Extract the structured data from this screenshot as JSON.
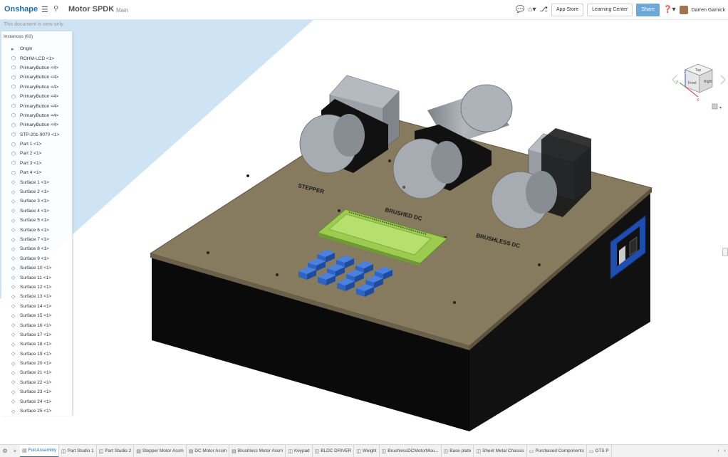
{
  "header": {
    "brand": "Onshape",
    "menu_icon": "hamburger-icon",
    "filter_icon": "filter-icon",
    "doc_title": "Motor SPDK",
    "doc_branch": "Main",
    "comment_icon": "comment-icon",
    "home_icon": "home-icon",
    "version_icon": "version-icon",
    "app_store": "App Store",
    "learning_center": "Learning Center",
    "share": "Share",
    "help_icon": "help-icon",
    "user": "Darren Garnick"
  },
  "readonly_notice": "This document is view only.",
  "feature_panel": {
    "title": "Instances (63)",
    "items": [
      {
        "icon": "chevron-icon",
        "label": "Origin"
      },
      {
        "icon": "part-icon",
        "label": "ROHM-LCD <1>"
      },
      {
        "icon": "part-icon",
        "label": "PrimaryButton <4>"
      },
      {
        "icon": "part-icon",
        "label": "PrimaryButton <4>"
      },
      {
        "icon": "part-icon",
        "label": "PrimaryButton <4>"
      },
      {
        "icon": "part-icon",
        "label": "PrimaryButton <4>"
      },
      {
        "icon": "part-icon",
        "label": "PrimaryButton <4>"
      },
      {
        "icon": "part-icon",
        "label": "PrimaryButton <4>"
      },
      {
        "icon": "part-icon",
        "label": "PrimaryButton <4>"
      },
      {
        "icon": "part-icon",
        "label": "STP-201-9070 <1>"
      },
      {
        "icon": "part-icon",
        "label": "Part 1 <1>"
      },
      {
        "icon": "part-icon",
        "label": "Part 2 <1>"
      },
      {
        "icon": "part-icon",
        "label": "Part 3 <1>"
      },
      {
        "icon": "part-icon",
        "label": "Part 4 <1>"
      },
      {
        "icon": "surface-icon",
        "label": "Surface 1 <1>"
      },
      {
        "icon": "surface-icon",
        "label": "Surface 2 <1>"
      },
      {
        "icon": "surface-icon",
        "label": "Surface 3 <1>"
      },
      {
        "icon": "surface-icon",
        "label": "Surface 4 <1>"
      },
      {
        "icon": "surface-icon",
        "label": "Surface 5 <1>"
      },
      {
        "icon": "surface-icon",
        "label": "Surface 6 <1>"
      },
      {
        "icon": "surface-icon",
        "label": "Surface 7 <1>"
      },
      {
        "icon": "surface-icon",
        "label": "Surface 8 <1>"
      },
      {
        "icon": "surface-icon",
        "label": "Surface 9 <1>"
      },
      {
        "icon": "surface-icon",
        "label": "Surface 10 <1>"
      },
      {
        "icon": "surface-icon",
        "label": "Surface 11 <1>"
      },
      {
        "icon": "surface-icon",
        "label": "Surface 12 <1>"
      },
      {
        "icon": "surface-icon",
        "label": "Surface 13 <1>"
      },
      {
        "icon": "surface-icon",
        "label": "Surface 14 <1>"
      },
      {
        "icon": "surface-icon",
        "label": "Surface 15 <1>"
      },
      {
        "icon": "surface-icon",
        "label": "Surface 16 <1>"
      },
      {
        "icon": "surface-icon",
        "label": "Surface 17 <1>"
      },
      {
        "icon": "surface-icon",
        "label": "Surface 18 <1>"
      },
      {
        "icon": "surface-icon",
        "label": "Surface 19 <1>"
      },
      {
        "icon": "surface-icon",
        "label": "Surface 20 <1>"
      },
      {
        "icon": "surface-icon",
        "label": "Surface 21 <1>"
      },
      {
        "icon": "surface-icon",
        "label": "Surface 22 <1>"
      },
      {
        "icon": "surface-icon",
        "label": "Surface 23 <1>"
      },
      {
        "icon": "surface-icon",
        "label": "Surface 24 <1>"
      },
      {
        "icon": "surface-icon",
        "label": "Surface 25 <1>"
      }
    ]
  },
  "model_labels": {
    "stepper": "STEPPER",
    "brushed": "BRUSHED DC",
    "brushless": "BRUSHLESS DC"
  },
  "view_cube": {
    "top": "Top",
    "front": "Front",
    "right": "Right",
    "axis_x": "X",
    "axis_y": "Y",
    "axis_z": "Z"
  },
  "colors": {
    "accent": "#1f6fb0",
    "plate": "#867a5f",
    "lcd": "#a6d65a",
    "keys": "#2f64c4",
    "base": "#0c0c0c"
  },
  "tabs": [
    {
      "icon": "assembly-icon",
      "label": "Full Assembly",
      "active": true
    },
    {
      "icon": "part-studio-icon",
      "label": "Part Studio 1"
    },
    {
      "icon": "part-studio-icon",
      "label": "Part Studio 2"
    },
    {
      "icon": "assembly-icon",
      "label": "Stepper Motor Assm"
    },
    {
      "icon": "assembly-icon",
      "label": "DC Motor Assm"
    },
    {
      "icon": "assembly-icon",
      "label": "Brushless Motor Assm"
    },
    {
      "icon": "part-studio-icon",
      "label": "Keypad"
    },
    {
      "icon": "part-studio-icon",
      "label": "BLDC DRIVER"
    },
    {
      "icon": "part-studio-icon",
      "label": "Weight"
    },
    {
      "icon": "part-studio-icon",
      "label": "BrushlessDCMotorMou..."
    },
    {
      "icon": "part-studio-icon",
      "label": "Base plate"
    },
    {
      "icon": "part-studio-icon",
      "label": "Sheet Metal Chassis"
    },
    {
      "icon": "folder-icon",
      "label": "Purchased Components"
    },
    {
      "icon": "folder-icon",
      "label": "OTS P"
    }
  ]
}
